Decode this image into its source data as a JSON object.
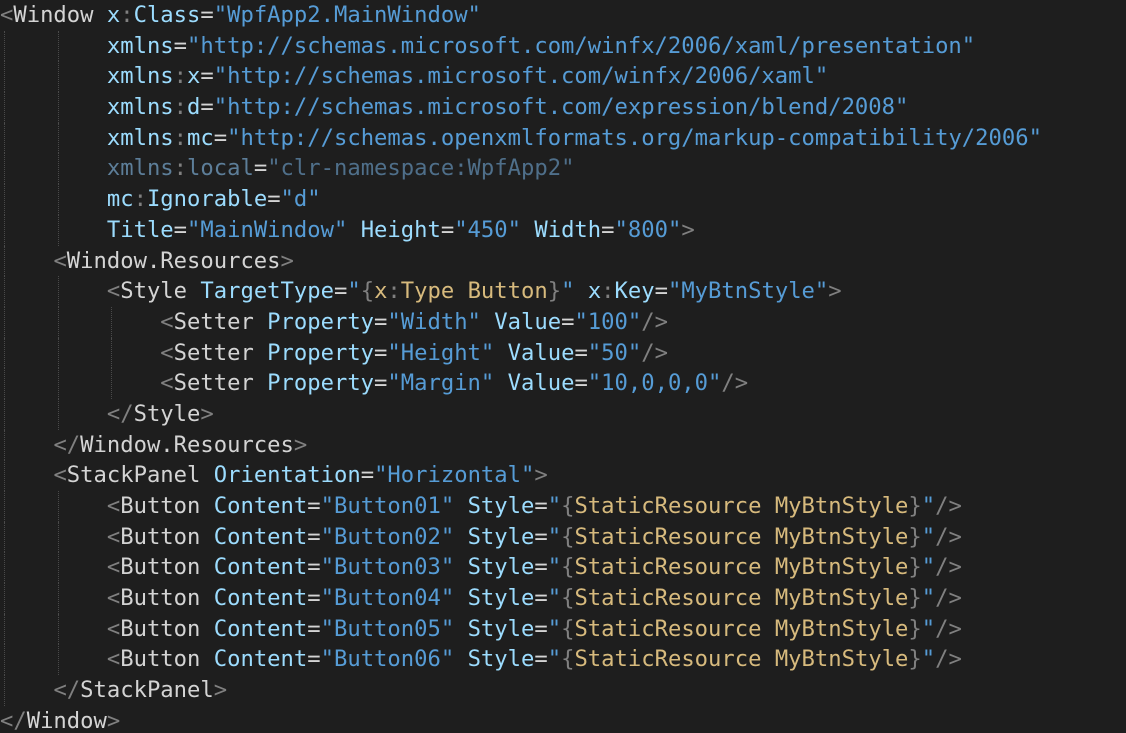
{
  "theme": {
    "background": "#1e1e1e",
    "tag_color": "#d4d4d4",
    "punct_color": "#808080",
    "attr_color": "#9cdcfe",
    "string_color": "#569cd6",
    "resource_color": "#d7ba7d",
    "dimmed_color": "#5d7e99"
  },
  "lines": [
    {
      "indent": 0,
      "tokens": [
        [
          "punct",
          "<"
        ],
        [
          "tag",
          "Window"
        ],
        [
          "sp",
          " "
        ],
        [
          "attr",
          "x"
        ],
        [
          "punct",
          ":"
        ],
        [
          "attr",
          "Class"
        ],
        [
          "eq",
          "="
        ],
        [
          "str",
          "\"WpfApp2.MainWindow\""
        ]
      ]
    },
    {
      "indent": 8,
      "tokens": [
        [
          "attr",
          "xmlns"
        ],
        [
          "eq",
          "="
        ],
        [
          "str",
          "\"http://schemas.microsoft.com/winfx/2006/xaml/presentation\""
        ]
      ]
    },
    {
      "indent": 8,
      "tokens": [
        [
          "attr",
          "xmlns"
        ],
        [
          "punct",
          ":"
        ],
        [
          "attr",
          "x"
        ],
        [
          "eq",
          "="
        ],
        [
          "str",
          "\"http://schemas.microsoft.com/winfx/2006/xaml\""
        ]
      ]
    },
    {
      "indent": 8,
      "tokens": [
        [
          "attr",
          "xmlns"
        ],
        [
          "punct",
          ":"
        ],
        [
          "attr",
          "d"
        ],
        [
          "eq",
          "="
        ],
        [
          "str",
          "\"http://schemas.microsoft.com/expression/blend/2008\""
        ]
      ]
    },
    {
      "indent": 8,
      "tokens": [
        [
          "attr",
          "xmlns"
        ],
        [
          "punct",
          ":"
        ],
        [
          "attr",
          "mc"
        ],
        [
          "eq",
          "="
        ],
        [
          "str",
          "\"http://schemas.openxmlformats.org/markup-compatibility/2006\""
        ]
      ]
    },
    {
      "indent": 8,
      "tokens": [
        [
          "dim",
          "xmlns"
        ],
        [
          "punct",
          ":"
        ],
        [
          "dim",
          "local"
        ],
        [
          "eq",
          "="
        ],
        [
          "dimstr",
          "\"clr-namespace:WpfApp2\""
        ]
      ]
    },
    {
      "indent": 8,
      "tokens": [
        [
          "attr",
          "mc"
        ],
        [
          "punct",
          ":"
        ],
        [
          "attr",
          "Ignorable"
        ],
        [
          "eq",
          "="
        ],
        [
          "str",
          "\"d\""
        ]
      ]
    },
    {
      "indent": 8,
      "tokens": [
        [
          "attr",
          "Title"
        ],
        [
          "eq",
          "="
        ],
        [
          "str",
          "\"MainWindow\""
        ],
        [
          "sp",
          " "
        ],
        [
          "attr",
          "Height"
        ],
        [
          "eq",
          "="
        ],
        [
          "str",
          "\"450\""
        ],
        [
          "sp",
          " "
        ],
        [
          "attr",
          "Width"
        ],
        [
          "eq",
          "="
        ],
        [
          "str",
          "\"800\""
        ],
        [
          "punct",
          ">"
        ]
      ]
    },
    {
      "indent": 4,
      "tokens": [
        [
          "punct",
          "<"
        ],
        [
          "tag",
          "Window.Resources"
        ],
        [
          "punct",
          ">"
        ]
      ]
    },
    {
      "indent": 8,
      "tokens": [
        [
          "punct",
          "<"
        ],
        [
          "tag",
          "Style"
        ],
        [
          "sp",
          " "
        ],
        [
          "attr",
          "TargetType"
        ],
        [
          "eq",
          "="
        ],
        [
          "str",
          "\""
        ],
        [
          "punct",
          "{"
        ],
        [
          "res",
          "x"
        ],
        [
          "punct",
          ":"
        ],
        [
          "res",
          "Type"
        ],
        [
          "sp",
          " "
        ],
        [
          "res",
          "Button"
        ],
        [
          "punct",
          "}"
        ],
        [
          "str",
          "\""
        ],
        [
          "sp",
          " "
        ],
        [
          "attr",
          "x"
        ],
        [
          "punct",
          ":"
        ],
        [
          "attr",
          "Key"
        ],
        [
          "eq",
          "="
        ],
        [
          "str",
          "\"MyBtnStyle\""
        ],
        [
          "punct",
          ">"
        ]
      ]
    },
    {
      "indent": 12,
      "tokens": [
        [
          "punct",
          "<"
        ],
        [
          "tag",
          "Setter"
        ],
        [
          "sp",
          " "
        ],
        [
          "attr",
          "Property"
        ],
        [
          "eq",
          "="
        ],
        [
          "str",
          "\"Width\""
        ],
        [
          "sp",
          " "
        ],
        [
          "attr",
          "Value"
        ],
        [
          "eq",
          "="
        ],
        [
          "str",
          "\"100\""
        ],
        [
          "punct",
          "/>"
        ]
      ]
    },
    {
      "indent": 12,
      "tokens": [
        [
          "punct",
          "<"
        ],
        [
          "tag",
          "Setter"
        ],
        [
          "sp",
          " "
        ],
        [
          "attr",
          "Property"
        ],
        [
          "eq",
          "="
        ],
        [
          "str",
          "\"Height\""
        ],
        [
          "sp",
          " "
        ],
        [
          "attr",
          "Value"
        ],
        [
          "eq",
          "="
        ],
        [
          "str",
          "\"50\""
        ],
        [
          "punct",
          "/>"
        ]
      ]
    },
    {
      "indent": 12,
      "tokens": [
        [
          "punct",
          "<"
        ],
        [
          "tag",
          "Setter"
        ],
        [
          "sp",
          " "
        ],
        [
          "attr",
          "Property"
        ],
        [
          "eq",
          "="
        ],
        [
          "str",
          "\"Margin\""
        ],
        [
          "sp",
          " "
        ],
        [
          "attr",
          "Value"
        ],
        [
          "eq",
          "="
        ],
        [
          "str",
          "\"10,0,0,0\""
        ],
        [
          "punct",
          "/>"
        ]
      ]
    },
    {
      "indent": 8,
      "tokens": [
        [
          "punct",
          "</"
        ],
        [
          "tag",
          "Style"
        ],
        [
          "punct",
          ">"
        ]
      ]
    },
    {
      "indent": 4,
      "tokens": [
        [
          "punct",
          "</"
        ],
        [
          "tag",
          "Window.Resources"
        ],
        [
          "punct",
          ">"
        ]
      ]
    },
    {
      "indent": 4,
      "tokens": [
        [
          "punct",
          "<"
        ],
        [
          "tag",
          "StackPanel"
        ],
        [
          "sp",
          " "
        ],
        [
          "attr",
          "Orientation"
        ],
        [
          "eq",
          "="
        ],
        [
          "str",
          "\"Horizontal\""
        ],
        [
          "punct",
          ">"
        ]
      ]
    },
    {
      "indent": 8,
      "tokens": [
        [
          "punct",
          "<"
        ],
        [
          "tag",
          "Button"
        ],
        [
          "sp",
          " "
        ],
        [
          "attr",
          "Content"
        ],
        [
          "eq",
          "="
        ],
        [
          "str",
          "\"Button01\""
        ],
        [
          "sp",
          " "
        ],
        [
          "attr",
          "Style"
        ],
        [
          "eq",
          "="
        ],
        [
          "str",
          "\""
        ],
        [
          "punct",
          "{"
        ],
        [
          "res",
          "StaticResource"
        ],
        [
          "sp",
          " "
        ],
        [
          "res",
          "MyBtnStyle"
        ],
        [
          "punct",
          "}"
        ],
        [
          "str",
          "\""
        ],
        [
          "punct",
          "/>"
        ]
      ]
    },
    {
      "indent": 8,
      "tokens": [
        [
          "punct",
          "<"
        ],
        [
          "tag",
          "Button"
        ],
        [
          "sp",
          " "
        ],
        [
          "attr",
          "Content"
        ],
        [
          "eq",
          "="
        ],
        [
          "str",
          "\"Button02\""
        ],
        [
          "sp",
          " "
        ],
        [
          "attr",
          "Style"
        ],
        [
          "eq",
          "="
        ],
        [
          "str",
          "\""
        ],
        [
          "punct",
          "{"
        ],
        [
          "res",
          "StaticResource"
        ],
        [
          "sp",
          " "
        ],
        [
          "res",
          "MyBtnStyle"
        ],
        [
          "punct",
          "}"
        ],
        [
          "str",
          "\""
        ],
        [
          "punct",
          "/>"
        ]
      ]
    },
    {
      "indent": 8,
      "tokens": [
        [
          "punct",
          "<"
        ],
        [
          "tag",
          "Button"
        ],
        [
          "sp",
          " "
        ],
        [
          "attr",
          "Content"
        ],
        [
          "eq",
          "="
        ],
        [
          "str",
          "\"Button03\""
        ],
        [
          "sp",
          " "
        ],
        [
          "attr",
          "Style"
        ],
        [
          "eq",
          "="
        ],
        [
          "str",
          "\""
        ],
        [
          "punct",
          "{"
        ],
        [
          "res",
          "StaticResource"
        ],
        [
          "sp",
          " "
        ],
        [
          "res",
          "MyBtnStyle"
        ],
        [
          "punct",
          "}"
        ],
        [
          "str",
          "\""
        ],
        [
          "punct",
          "/>"
        ]
      ]
    },
    {
      "indent": 8,
      "tokens": [
        [
          "punct",
          "<"
        ],
        [
          "tag",
          "Button"
        ],
        [
          "sp",
          " "
        ],
        [
          "attr",
          "Content"
        ],
        [
          "eq",
          "="
        ],
        [
          "str",
          "\"Button04\""
        ],
        [
          "sp",
          " "
        ],
        [
          "attr",
          "Style"
        ],
        [
          "eq",
          "="
        ],
        [
          "str",
          "\""
        ],
        [
          "punct",
          "{"
        ],
        [
          "res",
          "StaticResource"
        ],
        [
          "sp",
          " "
        ],
        [
          "res",
          "MyBtnStyle"
        ],
        [
          "punct",
          "}"
        ],
        [
          "str",
          "\""
        ],
        [
          "punct",
          "/>"
        ]
      ]
    },
    {
      "indent": 8,
      "tokens": [
        [
          "punct",
          "<"
        ],
        [
          "tag",
          "Button"
        ],
        [
          "sp",
          " "
        ],
        [
          "attr",
          "Content"
        ],
        [
          "eq",
          "="
        ],
        [
          "str",
          "\"Button05\""
        ],
        [
          "sp",
          " "
        ],
        [
          "attr",
          "Style"
        ],
        [
          "eq",
          "="
        ],
        [
          "str",
          "\""
        ],
        [
          "punct",
          "{"
        ],
        [
          "res",
          "StaticResource"
        ],
        [
          "sp",
          " "
        ],
        [
          "res",
          "MyBtnStyle"
        ],
        [
          "punct",
          "}"
        ],
        [
          "str",
          "\""
        ],
        [
          "punct",
          "/>"
        ]
      ]
    },
    {
      "indent": 8,
      "tokens": [
        [
          "punct",
          "<"
        ],
        [
          "tag",
          "Button"
        ],
        [
          "sp",
          " "
        ],
        [
          "attr",
          "Content"
        ],
        [
          "eq",
          "="
        ],
        [
          "str",
          "\"Button06\""
        ],
        [
          "sp",
          " "
        ],
        [
          "attr",
          "Style"
        ],
        [
          "eq",
          "="
        ],
        [
          "str",
          "\""
        ],
        [
          "punct",
          "{"
        ],
        [
          "res",
          "StaticResource"
        ],
        [
          "sp",
          " "
        ],
        [
          "res",
          "MyBtnStyle"
        ],
        [
          "punct",
          "}"
        ],
        [
          "str",
          "\""
        ],
        [
          "punct",
          "/>"
        ]
      ]
    },
    {
      "indent": 4,
      "tokens": [
        [
          "punct",
          "</"
        ],
        [
          "tag",
          "StackPanel"
        ],
        [
          "punct",
          ">"
        ]
      ]
    },
    {
      "indent": 0,
      "tokens": [
        [
          "punct",
          "</"
        ],
        [
          "tag",
          "Window"
        ],
        [
          "punct",
          ">"
        ]
      ]
    }
  ]
}
